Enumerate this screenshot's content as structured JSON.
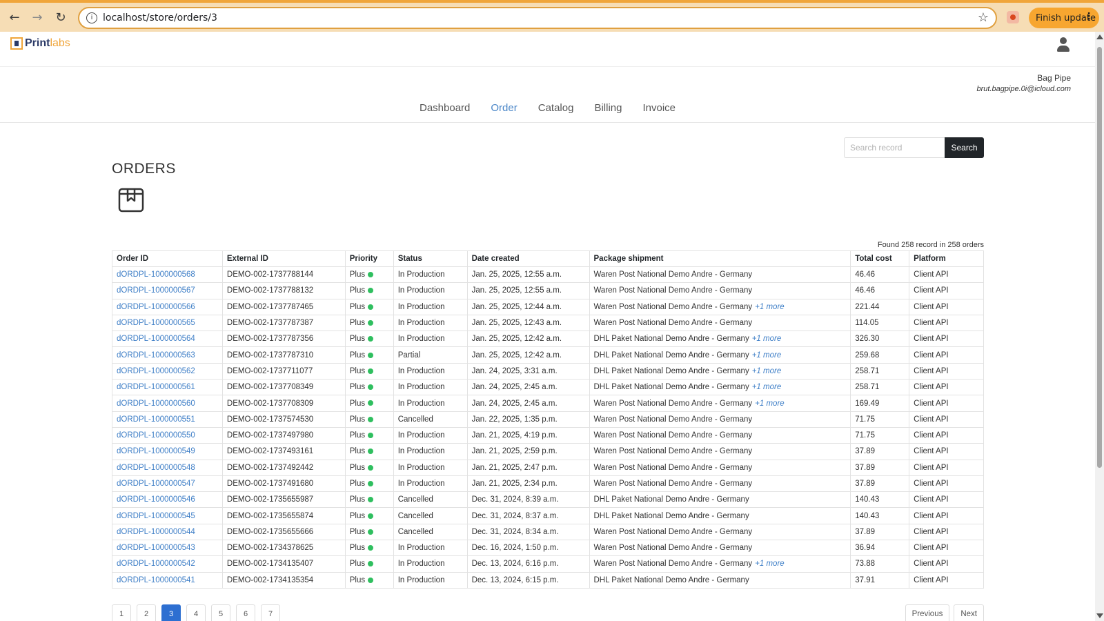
{
  "browser": {
    "url": "localhost/store/orders/3",
    "finish_update_label": "Finish update",
    "dots": "⋮"
  },
  "header": {
    "logo_part1": "Print",
    "logo_part2": "labs",
    "user_name": "Bag Pipe",
    "user_email": "brut.bagpipe.0i@icloud.com"
  },
  "nav": {
    "items": [
      "Dashboard",
      "Order",
      "Catalog",
      "Billing",
      "Invoice"
    ],
    "active": "Order"
  },
  "search": {
    "placeholder": "Search record",
    "button_label": "Search"
  },
  "page": {
    "title": "ORDERS",
    "found_text": "Found 258 record in 258 orders"
  },
  "colors": {
    "accent": "#4a86c8",
    "priority_dot": "#2fbf5f",
    "pager_active": "#2d6fd1"
  },
  "table": {
    "columns": [
      "Order ID",
      "External ID",
      "Priority",
      "Status",
      "Date created",
      "Package shipment",
      "Total cost",
      "Platform"
    ],
    "rows": [
      {
        "order_id": "dORDPL-1000000568",
        "external_id": "DEMO-002-1737788144",
        "priority": "Plus",
        "status": "In Production",
        "date": "Jan. 25, 2025, 12:55 a.m.",
        "shipment": "Waren Post National Demo Andre - Germany",
        "more": "",
        "total": "46.46",
        "platform": "Client API"
      },
      {
        "order_id": "dORDPL-1000000567",
        "external_id": "DEMO-002-1737788132",
        "priority": "Plus",
        "status": "In Production",
        "date": "Jan. 25, 2025, 12:55 a.m.",
        "shipment": "Waren Post National Demo Andre - Germany",
        "more": "",
        "total": "46.46",
        "platform": "Client API"
      },
      {
        "order_id": "dORDPL-1000000566",
        "external_id": "DEMO-002-1737787465",
        "priority": "Plus",
        "status": "In Production",
        "date": "Jan. 25, 2025, 12:44 a.m.",
        "shipment": "Waren Post National Demo Andre - Germany",
        "more": "+1 more",
        "total": "221.44",
        "platform": "Client API"
      },
      {
        "order_id": "dORDPL-1000000565",
        "external_id": "DEMO-002-1737787387",
        "priority": "Plus",
        "status": "In Production",
        "date": "Jan. 25, 2025, 12:43 a.m.",
        "shipment": "Waren Post National Demo Andre - Germany",
        "more": "",
        "total": "114.05",
        "platform": "Client API"
      },
      {
        "order_id": "dORDPL-1000000564",
        "external_id": "DEMO-002-1737787356",
        "priority": "Plus",
        "status": "In Production",
        "date": "Jan. 25, 2025, 12:42 a.m.",
        "shipment": "DHL Paket National Demo Andre - Germany",
        "more": "+1 more",
        "total": "326.30",
        "platform": "Client API"
      },
      {
        "order_id": "dORDPL-1000000563",
        "external_id": "DEMO-002-1737787310",
        "priority": "Plus",
        "status": "Partial",
        "date": "Jan. 25, 2025, 12:42 a.m.",
        "shipment": "DHL Paket National Demo Andre - Germany",
        "more": "+1 more",
        "total": "259.68",
        "platform": "Client API"
      },
      {
        "order_id": "dORDPL-1000000562",
        "external_id": "DEMO-002-1737711077",
        "priority": "Plus",
        "status": "In Production",
        "date": "Jan. 24, 2025, 3:31 a.m.",
        "shipment": "DHL Paket National Demo Andre - Germany",
        "more": "+1 more",
        "total": "258.71",
        "platform": "Client API"
      },
      {
        "order_id": "dORDPL-1000000561",
        "external_id": "DEMO-002-1737708349",
        "priority": "Plus",
        "status": "In Production",
        "date": "Jan. 24, 2025, 2:45 a.m.",
        "shipment": "DHL Paket National Demo Andre - Germany",
        "more": "+1 more",
        "total": "258.71",
        "platform": "Client API"
      },
      {
        "order_id": "dORDPL-1000000560",
        "external_id": "DEMO-002-1737708309",
        "priority": "Plus",
        "status": "In Production",
        "date": "Jan. 24, 2025, 2:45 a.m.",
        "shipment": "Waren Post National Demo Andre - Germany",
        "more": "+1 more",
        "total": "169.49",
        "platform": "Client API"
      },
      {
        "order_id": "dORDPL-1000000551",
        "external_id": "DEMO-002-1737574530",
        "priority": "Plus",
        "status": "Cancelled",
        "date": "Jan. 22, 2025, 1:35 p.m.",
        "shipment": "Waren Post National Demo Andre - Germany",
        "more": "",
        "total": "71.75",
        "platform": "Client API"
      },
      {
        "order_id": "dORDPL-1000000550",
        "external_id": "DEMO-002-1737497980",
        "priority": "Plus",
        "status": "In Production",
        "date": "Jan. 21, 2025, 4:19 p.m.",
        "shipment": "Waren Post National Demo Andre - Germany",
        "more": "",
        "total": "71.75",
        "platform": "Client API"
      },
      {
        "order_id": "dORDPL-1000000549",
        "external_id": "DEMO-002-1737493161",
        "priority": "Plus",
        "status": "In Production",
        "date": "Jan. 21, 2025, 2:59 p.m.",
        "shipment": "Waren Post National Demo Andre - Germany",
        "more": "",
        "total": "37.89",
        "platform": "Client API"
      },
      {
        "order_id": "dORDPL-1000000548",
        "external_id": "DEMO-002-1737492442",
        "priority": "Plus",
        "status": "In Production",
        "date": "Jan. 21, 2025, 2:47 p.m.",
        "shipment": "Waren Post National Demo Andre - Germany",
        "more": "",
        "total": "37.89",
        "platform": "Client API"
      },
      {
        "order_id": "dORDPL-1000000547",
        "external_id": "DEMO-002-1737491680",
        "priority": "Plus",
        "status": "In Production",
        "date": "Jan. 21, 2025, 2:34 p.m.",
        "shipment": "Waren Post National Demo Andre - Germany",
        "more": "",
        "total": "37.89",
        "platform": "Client API"
      },
      {
        "order_id": "dORDPL-1000000546",
        "external_id": "DEMO-002-1735655987",
        "priority": "Plus",
        "status": "Cancelled",
        "date": "Dec. 31, 2024, 8:39 a.m.",
        "shipment": "DHL Paket National Demo Andre - Germany",
        "more": "",
        "total": "140.43",
        "platform": "Client API"
      },
      {
        "order_id": "dORDPL-1000000545",
        "external_id": "DEMO-002-1735655874",
        "priority": "Plus",
        "status": "Cancelled",
        "date": "Dec. 31, 2024, 8:37 a.m.",
        "shipment": "DHL Paket National Demo Andre - Germany",
        "more": "",
        "total": "140.43",
        "platform": "Client API"
      },
      {
        "order_id": "dORDPL-1000000544",
        "external_id": "DEMO-002-1735655666",
        "priority": "Plus",
        "status": "Cancelled",
        "date": "Dec. 31, 2024, 8:34 a.m.",
        "shipment": "Waren Post National Demo Andre - Germany",
        "more": "",
        "total": "37.89",
        "platform": "Client API"
      },
      {
        "order_id": "dORDPL-1000000543",
        "external_id": "DEMO-002-1734378625",
        "priority": "Plus",
        "status": "In Production",
        "date": "Dec. 16, 2024, 1:50 p.m.",
        "shipment": "Waren Post National Demo Andre - Germany",
        "more": "",
        "total": "36.94",
        "platform": "Client API"
      },
      {
        "order_id": "dORDPL-1000000542",
        "external_id": "DEMO-002-1734135407",
        "priority": "Plus",
        "status": "In Production",
        "date": "Dec. 13, 2024, 6:16 p.m.",
        "shipment": "Waren Post National Demo Andre - Germany",
        "more": "+1 more",
        "total": "73.88",
        "platform": "Client API"
      },
      {
        "order_id": "dORDPL-1000000541",
        "external_id": "DEMO-002-1734135354",
        "priority": "Plus",
        "status": "In Production",
        "date": "Dec. 13, 2024, 6:15 p.m.",
        "shipment": "DHL Paket National Demo Andre - Germany",
        "more": "",
        "total": "37.91",
        "platform": "Client API"
      }
    ]
  },
  "pagination": {
    "pages": [
      "1",
      "2",
      "3",
      "4",
      "5",
      "6",
      "7"
    ],
    "current": "3",
    "previous_label": "Previous",
    "next_label": "Next"
  }
}
